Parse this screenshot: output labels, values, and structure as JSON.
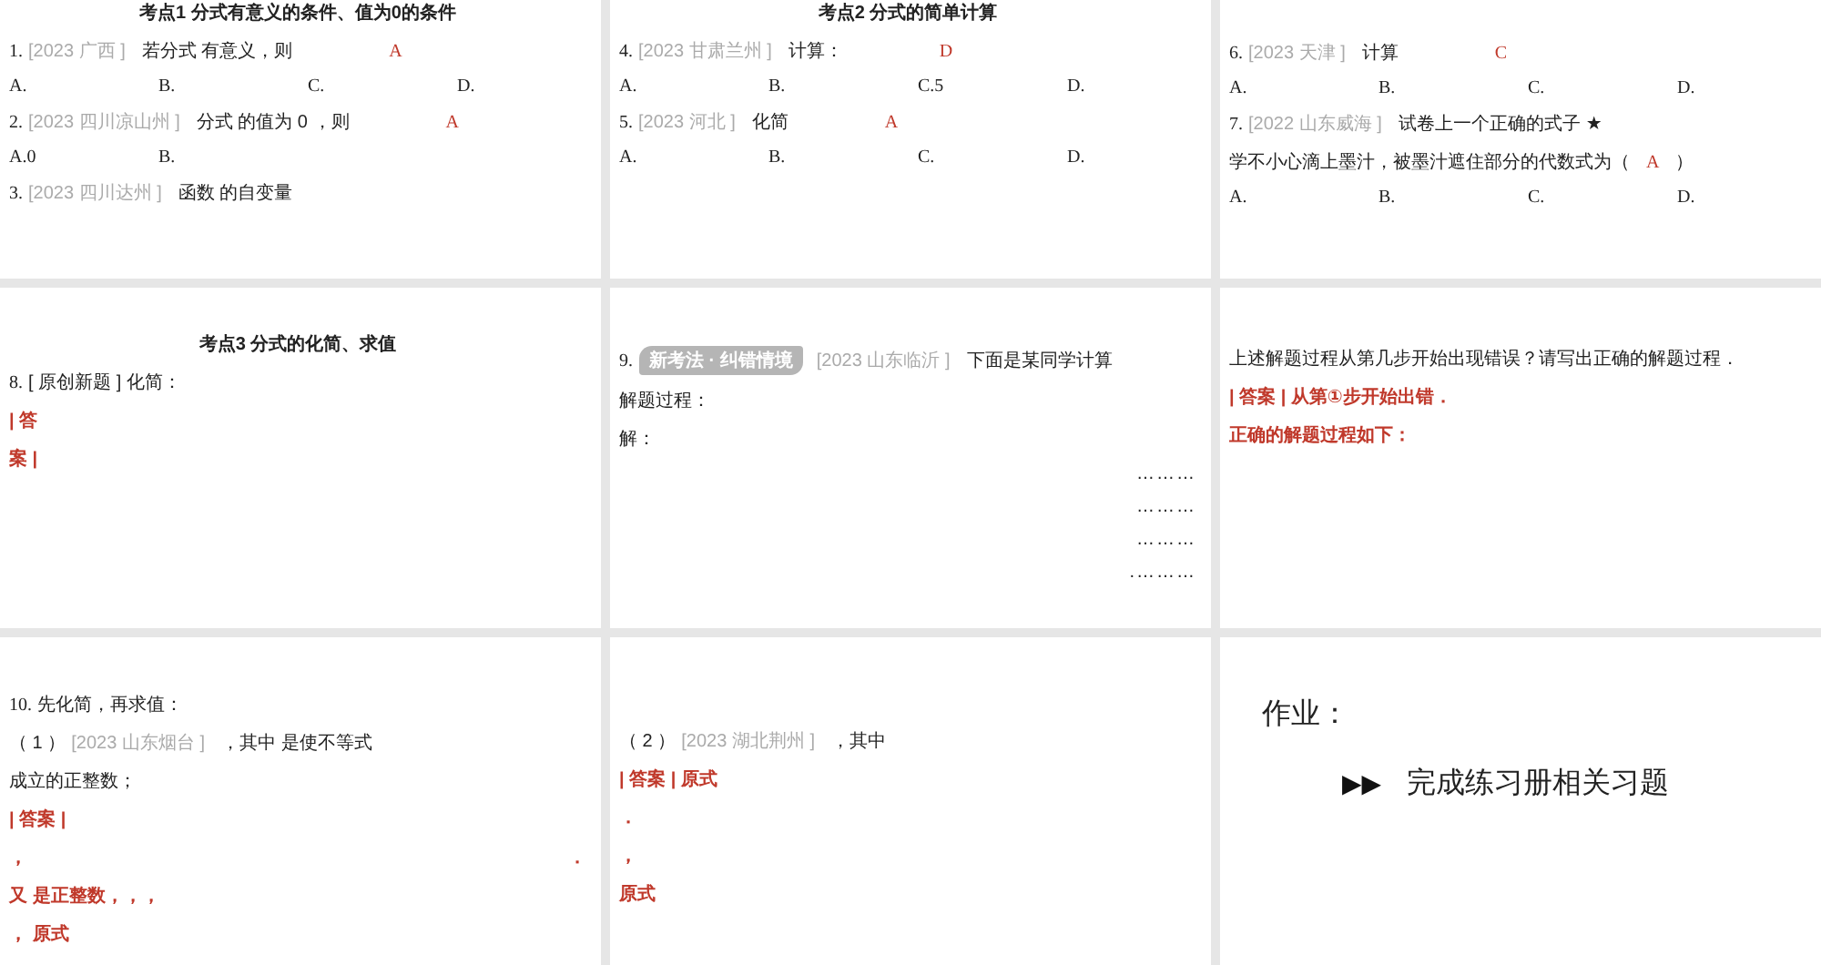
{
  "slides": [
    {
      "selected": false,
      "lines": [
        {
          "kind": "title",
          "parts": [
            {
              "kind": "text",
              "text": "考点1  分式有意义的条件、值为0的条件"
            }
          ]
        },
        {
          "kind": "row",
          "parts": [
            {
              "kind": "num",
              "text": "1."
            },
            {
              "kind": "source",
              "text": "[2023 广西 ]"
            },
            {
              "kind": "text",
              "text": "若分式 有意义，则"
            },
            {
              "kind": "answer",
              "text": "A"
            }
          ]
        },
        {
          "kind": "options",
          "parts": [
            {
              "kind": "option",
              "text": "A."
            },
            {
              "kind": "option",
              "text": "B."
            },
            {
              "kind": "option",
              "text": "C."
            },
            {
              "kind": "option",
              "text": "D."
            }
          ]
        },
        {
          "kind": "row",
          "parts": [
            {
              "kind": "num",
              "text": "2."
            },
            {
              "kind": "source",
              "text": "[2023 四川凉山州 ]"
            },
            {
              "kind": "text",
              "text": "分式 的值为 0 ，则"
            },
            {
              "kind": "answer",
              "text": "A"
            }
          ]
        },
        {
          "kind": "options",
          "parts": [
            {
              "kind": "option",
              "text": "A.0"
            },
            {
              "kind": "option",
              "text": "B."
            }
          ]
        },
        {
          "kind": "row",
          "parts": [
            {
              "kind": "num",
              "text": "3."
            },
            {
              "kind": "source",
              "text": "[2023 四川达州 ]"
            },
            {
              "kind": "text",
              "text": "函数 的自变量"
            }
          ]
        }
      ]
    },
    {
      "selected": false,
      "lines": [
        {
          "kind": "title",
          "parts": [
            {
              "kind": "text",
              "text": "考点2  分式的简单计算"
            }
          ]
        },
        {
          "kind": "row",
          "parts": [
            {
              "kind": "num",
              "text": "4."
            },
            {
              "kind": "source",
              "text": "[2023 甘肃兰州 ]"
            },
            {
              "kind": "text",
              "text": "计算："
            },
            {
              "kind": "answer",
              "text": "D"
            }
          ]
        },
        {
          "kind": "options",
          "parts": [
            {
              "kind": "option",
              "text": "A."
            },
            {
              "kind": "option",
              "text": "B."
            },
            {
              "kind": "option",
              "text": "C.5"
            },
            {
              "kind": "option",
              "text": "D."
            }
          ]
        },
        {
          "kind": "row",
          "parts": [
            {
              "kind": "num",
              "text": "5."
            },
            {
              "kind": "source",
              "text": "[2023 河北 ]"
            },
            {
              "kind": "text",
              "text": "化简"
            },
            {
              "kind": "answer",
              "text": "A"
            }
          ]
        },
        {
          "kind": "options",
          "parts": [
            {
              "kind": "option",
              "text": "A."
            },
            {
              "kind": "option",
              "text": "B."
            },
            {
              "kind": "option",
              "text": "C."
            },
            {
              "kind": "option",
              "text": "D."
            }
          ]
        }
      ]
    },
    {
      "selected": false,
      "lines": [
        {
          "kind": "row",
          "parts": [
            {
              "kind": "num",
              "text": "6."
            },
            {
              "kind": "source",
              "text": "[2023 天津 ]"
            },
            {
              "kind": "text",
              "text": "计算"
            },
            {
              "kind": "answer",
              "text": "C"
            }
          ]
        },
        {
          "kind": "options",
          "parts": [
            {
              "kind": "option",
              "text": "A."
            },
            {
              "kind": "option",
              "text": "B."
            },
            {
              "kind": "option",
              "text": "C."
            },
            {
              "kind": "option",
              "text": "D."
            }
          ]
        },
        {
          "kind": "row",
          "parts": [
            {
              "kind": "num",
              "text": "7."
            },
            {
              "kind": "source",
              "text": "[2022 山东威海 ]"
            },
            {
              "kind": "text",
              "text": "试卷上一个正确的式子"
            },
            {
              "kind": "text",
              "text": "★"
            }
          ]
        },
        {
          "kind": "row",
          "parts": [
            {
              "kind": "text",
              "text": "学不小心滴上墨汁，被墨汁遮住部分的代数式为（"
            },
            {
              "kind": "inline-answer",
              "text": "A"
            },
            {
              "kind": "text",
              "text": "）"
            }
          ]
        },
        {
          "kind": "options",
          "parts": [
            {
              "kind": "option",
              "text": "A."
            },
            {
              "kind": "option",
              "text": "B."
            },
            {
              "kind": "option",
              "text": "C."
            },
            {
              "kind": "option",
              "text": "D."
            }
          ]
        }
      ]
    },
    {
      "selected": false,
      "lines": [
        {
          "kind": "title",
          "parts": [
            {
              "kind": "text",
              "text": "考点3  分式的化简、求值"
            }
          ]
        },
        {
          "kind": "row",
          "parts": [
            {
              "kind": "num",
              "text": "8."
            },
            {
              "kind": "text",
              "text": "[ 原创新题 ] 化简："
            }
          ]
        },
        {
          "kind": "row",
          "parts": [
            {
              "kind": "note",
              "text": "| 答"
            }
          ]
        },
        {
          "kind": "row",
          "parts": [
            {
              "kind": "note",
              "text": "案 |"
            }
          ]
        }
      ]
    },
    {
      "selected": false,
      "lines": [
        {
          "kind": "row",
          "parts": [
            {
              "kind": "num",
              "text": "9."
            },
            {
              "kind": "badge",
              "text": "新考法 · 纠错情境"
            },
            {
              "kind": "source",
              "text": "[2023 山东临沂 ]"
            },
            {
              "kind": "text",
              "text": "下面是某同学计算"
            }
          ]
        },
        {
          "kind": "row",
          "parts": [
            {
              "kind": "text",
              "text": "解题过程："
            }
          ]
        },
        {
          "kind": "row",
          "parts": [
            {
              "kind": "text",
              "text": "解："
            }
          ]
        },
        {
          "kind": "dots",
          "parts": [
            {
              "kind": "dots",
              "text": "………"
            }
          ]
        },
        {
          "kind": "dots",
          "parts": [
            {
              "kind": "dots",
              "text": "………"
            }
          ]
        },
        {
          "kind": "dots",
          "parts": [
            {
              "kind": "dots",
              "text": "………"
            }
          ]
        },
        {
          "kind": "dots",
          "parts": [
            {
              "kind": "dots",
              "text": ".………"
            }
          ]
        }
      ]
    },
    {
      "selected": false,
      "lines": [
        {
          "kind": "row",
          "parts": [
            {
              "kind": "text",
              "text": "上述解题过程从第几步开始出现错误？请写出正确的解题过程．"
            }
          ]
        },
        {
          "kind": "row",
          "parts": [
            {
              "kind": "note",
              "text": "| 答案 |  从第①步开始出错．"
            }
          ]
        },
        {
          "kind": "row",
          "parts": [
            {
              "kind": "note",
              "text": "正确的解题过程如下："
            }
          ]
        }
      ]
    },
    {
      "selected": false,
      "lines": [
        {
          "kind": "row",
          "parts": [
            {
              "kind": "num",
              "text": "10."
            },
            {
              "kind": "text",
              "text": "先化简，再求值："
            }
          ]
        },
        {
          "kind": "row",
          "parts": [
            {
              "kind": "text",
              "text": "（ 1 ）"
            },
            {
              "kind": "source",
              "text": "[2023 山东烟台 ]"
            },
            {
              "kind": "text",
              "text": "，其中 是使不等式"
            }
          ]
        },
        {
          "kind": "row",
          "parts": [
            {
              "kind": "text",
              "text": "成立的正整数；"
            }
          ]
        },
        {
          "kind": "row",
          "parts": [
            {
              "kind": "note",
              "text": "| 答案 |"
            }
          ]
        },
        {
          "kind": "spread",
          "parts": [
            {
              "kind": "note",
              "text": "，"
            },
            {
              "kind": "note",
              "text": "．"
            }
          ]
        },
        {
          "kind": "row",
          "parts": [
            {
              "kind": "note",
              "text": "又 是正整数，，，"
            }
          ]
        },
        {
          "kind": "row",
          "parts": [
            {
              "kind": "note",
              "text": "，   原式"
            }
          ]
        }
      ]
    },
    {
      "selected": false,
      "lines": [
        {
          "kind": "row",
          "parts": [
            {
              "kind": "text",
              "text": "（ 2 ）"
            },
            {
              "kind": "source",
              "text": "[2023 湖北荆州 ]"
            },
            {
              "kind": "text",
              "text": "，其中"
            }
          ]
        },
        {
          "kind": "row",
          "parts": [
            {
              "kind": "note",
              "text": "| 答案 |  原式"
            }
          ]
        },
        {
          "kind": "row",
          "parts": [
            {
              "kind": "note",
              "text": "．"
            }
          ]
        },
        {
          "kind": "row",
          "parts": [
            {
              "kind": "note",
              "text": "，"
            }
          ]
        },
        {
          "kind": "row",
          "parts": [
            {
              "kind": "note",
              "text": "   原式"
            }
          ]
        }
      ]
    },
    {
      "selected": false,
      "lines": [
        {
          "kind": "heading",
          "parts": [
            {
              "kind": "text",
              "text": "作业："
            }
          ]
        },
        {
          "kind": "bullet",
          "parts": [
            {
              "kind": "arrows",
              "text": "▶▶"
            },
            {
              "kind": "text",
              "text": "完成练习册相关习题"
            }
          ]
        }
      ]
    }
  ]
}
